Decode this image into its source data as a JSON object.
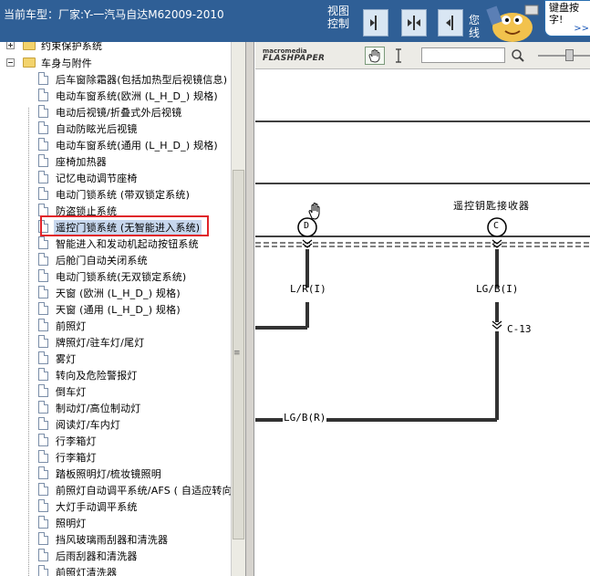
{
  "header": {
    "car_label": "当前车型：厂家:Y-一汽马自达M62009-2010",
    "view_control": "视图控制",
    "you_text": "您线",
    "tip_text": "键盘按字!",
    "tip_more": ">>"
  },
  "tree": {
    "folders": [
      {
        "label": "约束保护系统",
        "expanded": false
      },
      {
        "label": "车身与附件",
        "expanded": true
      }
    ],
    "items": [
      "后车窗除霜器(包括加热型后视镜信息)",
      "电动车窗系统(欧洲 (L_H_D_) 规格)",
      "电动后视镜/折叠式外后视镜",
      "自动防眩光后视镜",
      "电动车窗系统(通用 (L_H_D_) 规格)",
      "座椅加热器",
      "记忆电动调节座椅",
      "电动门锁系统 (带双锁定系统)",
      "防盗锁止系统",
      "遥控门锁系统 (无智能进入系统)",
      "智能进入和发动机起动按钮系统",
      "后舱门自动关闭系统",
      "电动门锁系统(无双锁定系统)",
      "天窗  (欧洲 (L_H_D_) 规格)",
      "天窗  (通用 (L_H_D_) 规格)",
      "前照灯",
      "牌照灯/驻车灯/尾灯",
      "雾灯",
      "转向及危险警报灯",
      "倒车灯",
      "制动灯/高位制动灯",
      "阅读灯/车内灯",
      "行李箱灯",
      "行李箱灯",
      "踏板照明灯/梳妆镜照明",
      "前照灯自动调平系统/AFS ( 自适应转向",
      "大灯手动调平系统",
      "照明灯",
      "挡风玻璃雨刮器和清洗器",
      "后雨刮器和清洗器",
      "前照灯清洗器"
    ],
    "selected_index": 9
  },
  "flash": {
    "brand_top": "macromedia",
    "brand_bottom": "FLASHPAPER",
    "search_value": ""
  },
  "diagram": {
    "component_label": "遥控钥匙接收器",
    "connector_d": "D",
    "connector_c": "C",
    "wire_left": "L/R(I)",
    "wire_right": "LG/B(I)",
    "splice": "C-13",
    "wire_bottom": "LG/B(R)"
  },
  "colors": {
    "header_bg": "#2f5f96",
    "highlight": "#e0242a",
    "selected_bg": "#c7d7ee"
  }
}
